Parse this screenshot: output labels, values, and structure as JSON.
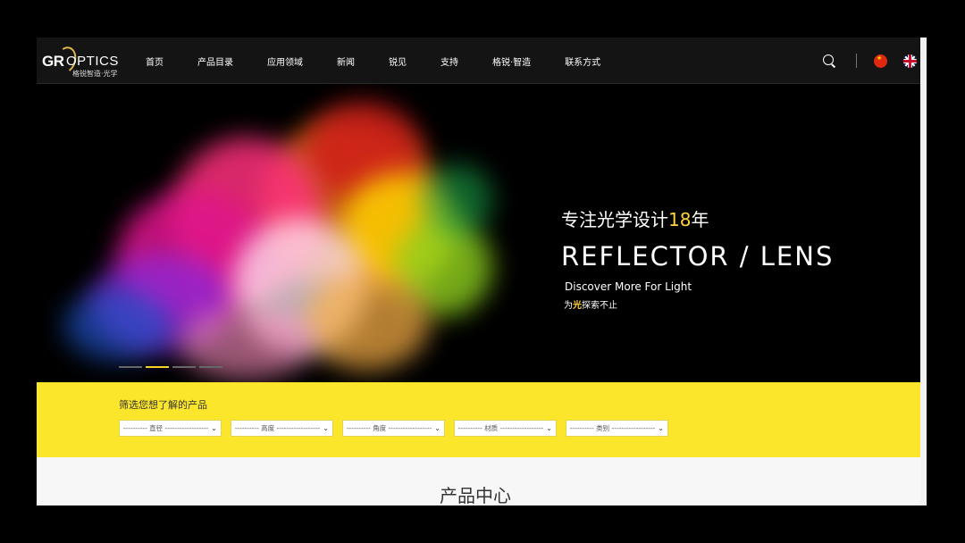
{
  "logo": {
    "brand_gr": "GR",
    "brand_optics": "OPTICS",
    "subtitle": "格锐智造·光学"
  },
  "nav": {
    "items": [
      {
        "label": "首页"
      },
      {
        "label": "产品目录"
      },
      {
        "label": "应用领域"
      },
      {
        "label": "新闻"
      },
      {
        "label": "锐见"
      },
      {
        "label": "支持"
      },
      {
        "label": "格锐·智造"
      },
      {
        "label": "联系方式"
      }
    ]
  },
  "tools": {
    "icons": [
      "search-icon",
      "flag-china-icon",
      "flag-uk-icon"
    ]
  },
  "hero": {
    "title_cn_prefix": "专注光学设计",
    "title_cn_years": "18",
    "title_cn_suffix": "年",
    "title_en": "REFLECTOR / LENS",
    "sub_en": "Discover More For Light",
    "sub_cn_prefix": "为",
    "sub_cn_highlight": "光",
    "sub_cn_suffix": "探索不止",
    "slides": 4,
    "active_slide": 2
  },
  "filter": {
    "title": "筛选您想了解的产品",
    "selects": [
      {
        "value": "---------- 直径 ------------------"
      },
      {
        "value": "---------- 高度 ------------------"
      },
      {
        "value": "---------- 角度 ------------------"
      },
      {
        "value": "---------- 材质 ------------------"
      },
      {
        "value": "---------- 类别 ------------------"
      }
    ]
  },
  "products": {
    "title": "产品中心"
  },
  "colors": {
    "accent_yellow": "#fce62b",
    "highlight": "#ffd43b",
    "nav_bg": "#141414"
  }
}
